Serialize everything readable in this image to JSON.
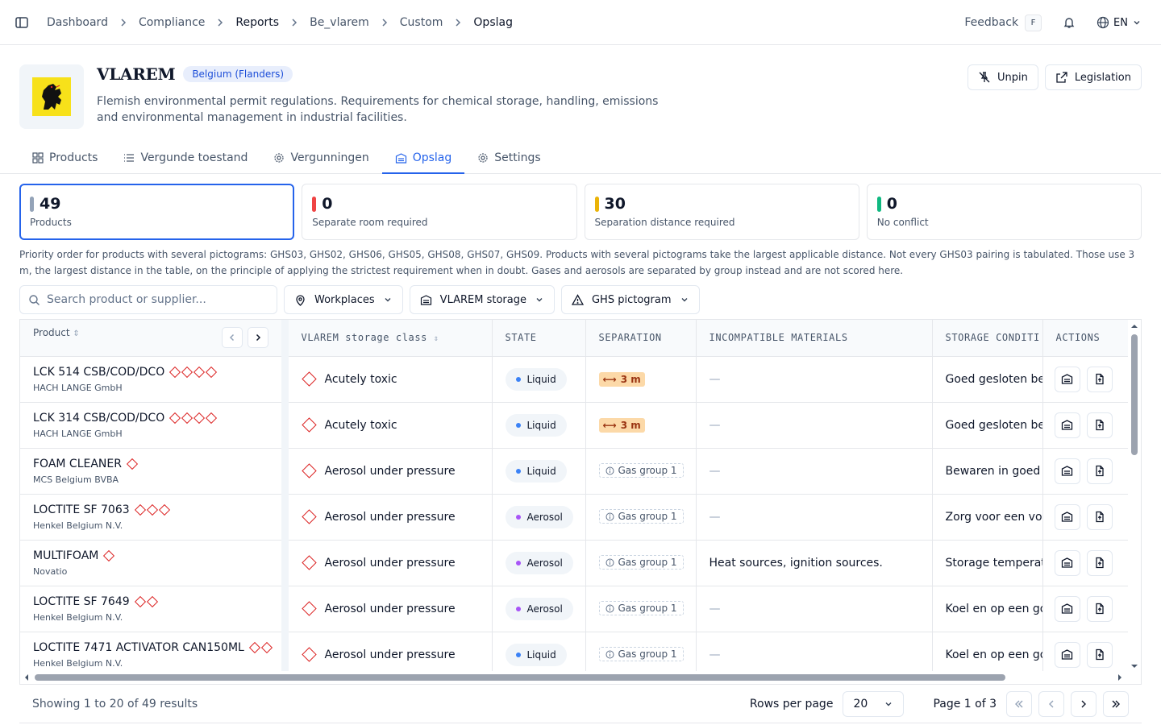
{
  "breadcrumb": [
    "Dashboard",
    "Compliance",
    "Reports",
    "Be_vlarem",
    "Custom",
    "Opslag"
  ],
  "topbar": {
    "feedback": "Feedback",
    "shortcut": "F",
    "language": "EN"
  },
  "header": {
    "title": "VLAREM",
    "region": "Belgium (Flanders)",
    "description": "Flemish environmental permit regulations. Requirements for chemical storage, handling, emissions and environmental management in industrial facilities.",
    "unpin": "Unpin",
    "legislation": "Legislation"
  },
  "tabs": [
    "Products",
    "Vergunde toestand",
    "Vergunningen",
    "Opslag",
    "Settings"
  ],
  "cards": [
    {
      "value": "49",
      "label": "Products",
      "color": "#94a3b8"
    },
    {
      "value": "0",
      "label": "Separate room required",
      "color": "#ef4444"
    },
    {
      "value": "30",
      "label": "Separation distance required",
      "color": "#eab308"
    },
    {
      "value": "0",
      "label": "No conflict",
      "color": "#10b981"
    }
  ],
  "note": "Priority order for products with several pictograms: GHS03, GHS02, GHS06, GHS05, GHS08, GHS07, GHS09. Products with several pictograms take the largest applicable distance. Not every GHS03 pairing is tabulated. Those use 3 m, the largest distance in the table, on the principle of applying the strictest requirement when in doubt. Gases and aerosols are separated by group instead and are not scored here.",
  "filters": {
    "search_placeholder": "Search product or supplier...",
    "workplaces": "Workplaces",
    "storage": "VLAREM storage",
    "ghs": "GHS pictogram"
  },
  "table": {
    "headers": {
      "product": "Product",
      "class": "VLAREM storage class",
      "state": "STATE",
      "separation": "SEPARATION",
      "incompatible": "INCOMPATIBLE MATERIALS",
      "storage": "STORAGE CONDITI",
      "actions": "ACTIONS"
    },
    "rows": [
      {
        "name": "LCK 514 CSB/COD/DCO",
        "supplier": "HACH LANGE GmbH",
        "pict": 4,
        "cls": "Acutely toxic",
        "state": "Liquid",
        "stateColor": "#3b82f6",
        "sep": "3 m",
        "sepType": "dist",
        "inc": "—",
        "storage": "Goed gesloten be"
      },
      {
        "name": "LCK 314 CSB/COD/DCO",
        "supplier": "HACH LANGE GmbH",
        "pict": 4,
        "cls": "Acutely toxic",
        "state": "Liquid",
        "stateColor": "#3b82f6",
        "sep": "3 m",
        "sepType": "dist",
        "inc": "—",
        "storage": "Goed gesloten be"
      },
      {
        "name": "FOAM CLEANER",
        "supplier": "MCS Belgium BVBA",
        "pict": 1,
        "cls": "Aerosol under pressure",
        "state": "Liquid",
        "stateColor": "#3b82f6",
        "sep": "Gas group 1",
        "sepType": "gas",
        "inc": "—",
        "storage": "Bewaren in goed g"
      },
      {
        "name": "LOCTITE SF 7063",
        "supplier": "Henkel Belgium N.V.",
        "pict": 3,
        "cls": "Aerosol under pressure",
        "state": "Aerosol",
        "stateColor": "#a855f7",
        "sep": "Gas group 1",
        "sepType": "gas",
        "inc": "—",
        "storage": "Zorg voor een vol"
      },
      {
        "name": "MULTIFOAM",
        "supplier": "Novatio",
        "pict": 1,
        "cls": "Aerosol under pressure",
        "state": "Aerosol",
        "stateColor": "#a855f7",
        "sep": "Gas group 1",
        "sepType": "gas",
        "inc": "Heat sources, ignition sources.",
        "storage": "Storage temperat"
      },
      {
        "name": "LOCTITE SF 7649",
        "supplier": "Henkel Belgium N.V.",
        "pict": 2,
        "cls": "Aerosol under pressure",
        "state": "Aerosol",
        "stateColor": "#a855f7",
        "sep": "Gas group 1",
        "sepType": "gas",
        "inc": "—",
        "storage": "Koel en op een go"
      },
      {
        "name": "LOCTITE 7471 ACTIVATOR CAN150ML",
        "supplier": "Henkel Belgium N.V.",
        "pict": 2,
        "cls": "Aerosol under pressure",
        "state": "Liquid",
        "stateColor": "#3b82f6",
        "sep": "Gas group 1",
        "sepType": "gas",
        "inc": "—",
        "storage": "Koel en op een go"
      }
    ]
  },
  "footer": {
    "showing": "Showing 1 to 20 of 49 results",
    "rows_per_page_label": "Rows per page",
    "rows_per_page": "20",
    "page": "Page 1 of 3"
  }
}
